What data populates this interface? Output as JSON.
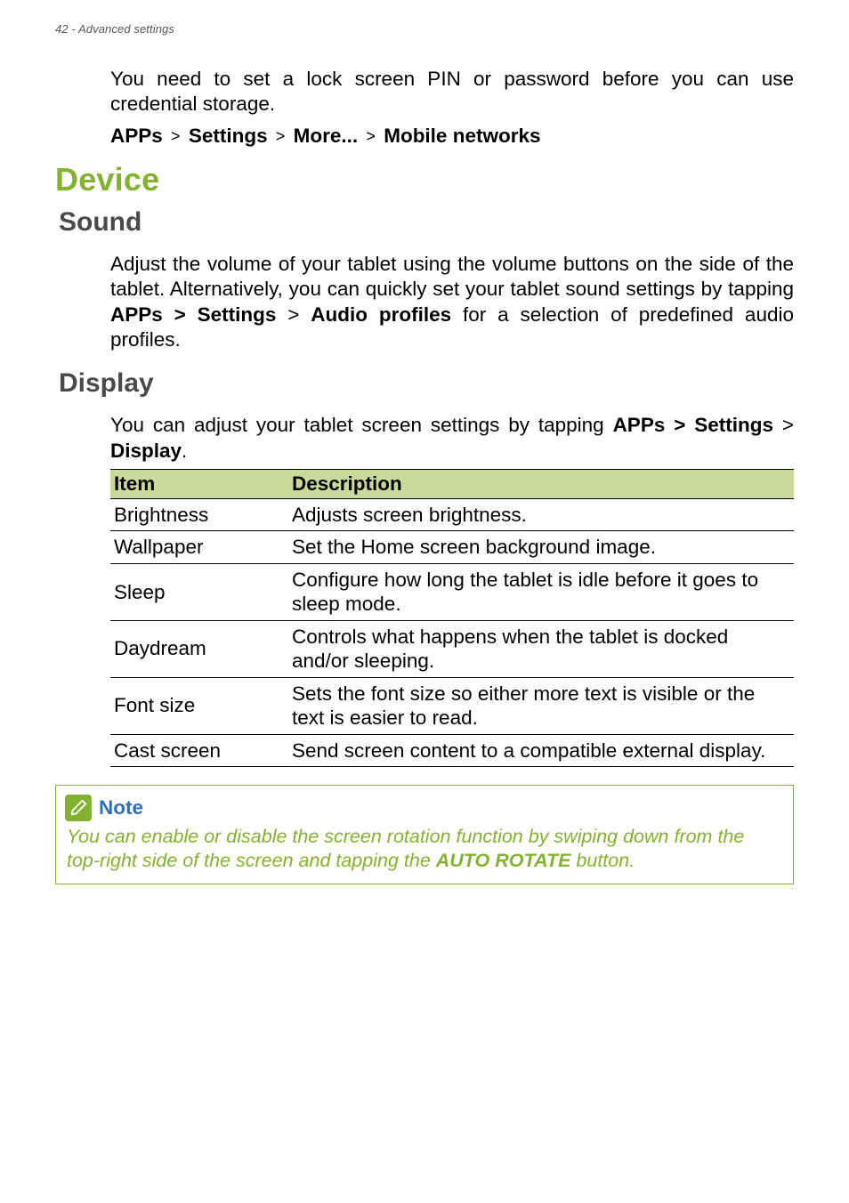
{
  "header": {
    "text": "42 - Advanced settings"
  },
  "intro": {
    "para1": "You need to set a lock screen PIN or password before you can use credential storage.",
    "crumbs": {
      "c1": "APPs",
      "c2": "Settings",
      "c3": "More...",
      "c4": "Mobile networks",
      "sep": ">"
    }
  },
  "device": {
    "title": "Device",
    "sound": {
      "title": "Sound",
      "para_pre": "Adjust the volume of your tablet using the volume buttons on the side of the tablet. Alternatively, you can quickly set your tablet sound settings by tapping ",
      "b1": "APPs > Settings",
      "mid": " > ",
      "b2": "Audio profiles",
      "post": " for a selection of predefined audio profiles."
    },
    "display": {
      "title": "Display",
      "para_pre": "You can adjust your tablet screen settings by tapping ",
      "b1": "APPs > Settings",
      "mid": " > ",
      "b2": "Display",
      "post": ".",
      "table": {
        "th1": "Item",
        "th2": "Description",
        "rows": [
          {
            "item": "Brightness",
            "desc": "Adjusts screen brightness."
          },
          {
            "item": "Wallpaper",
            "desc": "Set the Home screen background image."
          },
          {
            "item": "Sleep",
            "desc": "Configure how long the tablet is idle before it goes to sleep mode."
          },
          {
            "item": "Daydream",
            "desc": "Controls what happens when the tablet is docked and/or sleeping."
          },
          {
            "item": "Font size",
            "desc": "Sets the font size so either more text is visible or the text is easier to read."
          },
          {
            "item": "Cast screen",
            "desc": "Send screen content to a compatible external display."
          }
        ]
      }
    }
  },
  "note": {
    "title": "Note",
    "body_pre": "You can enable or disable the screen rotation function by swiping down from the top-right side of the screen and tapping the ",
    "body_bold": "AUTO ROTATE",
    "body_post": " button."
  }
}
